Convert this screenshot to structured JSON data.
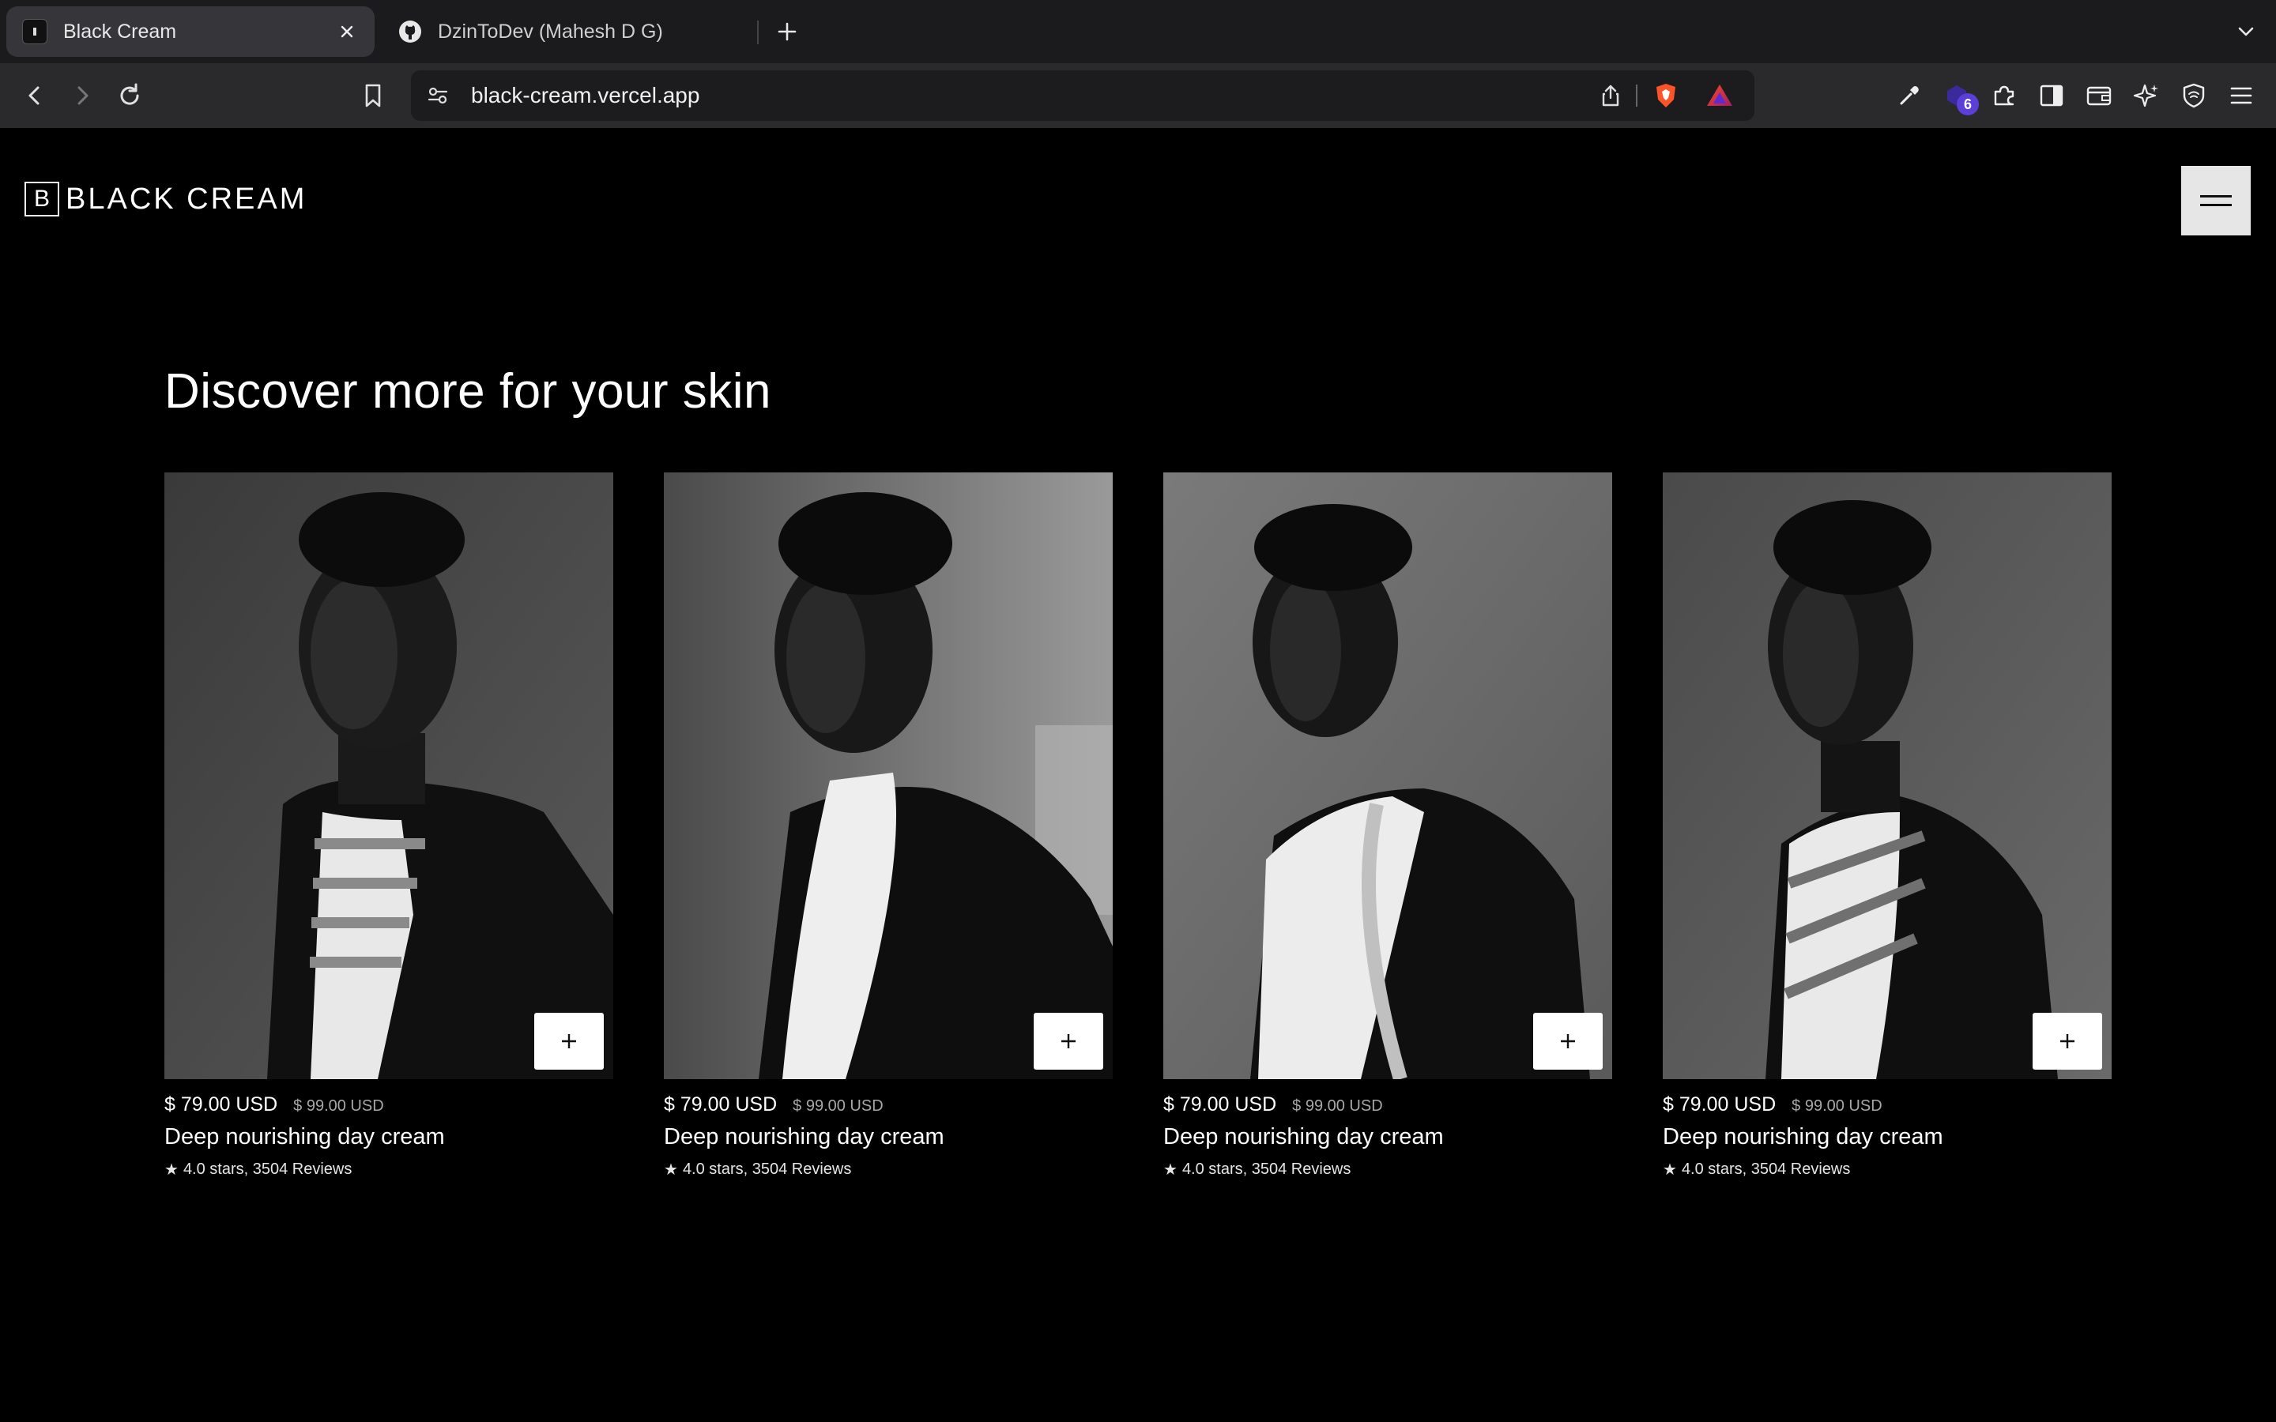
{
  "browser": {
    "tabs": [
      {
        "title": "Black Cream",
        "active": true
      },
      {
        "title": "DzinToDev (Mahesh D G)",
        "active": false
      }
    ],
    "url": "black-cream.vercel.app",
    "extensions_badge": "6"
  },
  "site": {
    "brand_mark": "B",
    "brand_name": "BLACK CREAM"
  },
  "section": {
    "heading": "Discover more for your skin"
  },
  "products": [
    {
      "price": "$ 79.00 USD",
      "old_price": "$ 99.00 USD",
      "name": "Deep nourishing day cream",
      "rating": "4.0 stars, 3504 Reviews",
      "add_label": "+"
    },
    {
      "price": "$ 79.00 USD",
      "old_price": "$ 99.00 USD",
      "name": "Deep nourishing day cream",
      "rating": "4.0 stars, 3504 Reviews",
      "add_label": "+"
    },
    {
      "price": "$ 79.00 USD",
      "old_price": "$ 99.00 USD",
      "name": "Deep nourishing day cream",
      "rating": "4.0 stars, 3504 Reviews",
      "add_label": "+"
    },
    {
      "price": "$ 79.00 USD",
      "old_price": "$ 99.00 USD",
      "name": "Deep nourishing day cream",
      "rating": "4.0 stars, 3504 Reviews",
      "add_label": "+"
    }
  ],
  "colors": {
    "page_background": "#000000",
    "text": "#ffffff",
    "muted_text": "#a8a8a8",
    "menu_button": "#e6e6e6",
    "browser_chrome": "#202124"
  }
}
